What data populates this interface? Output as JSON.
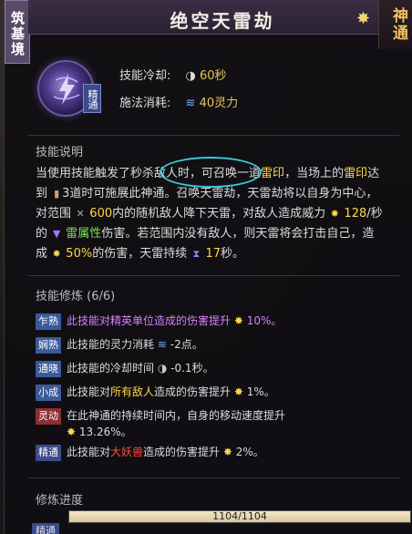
{
  "header": {
    "realm": "筑基境",
    "title": "绝空天雷劫",
    "badge": "神通"
  },
  "skill": {
    "grade": "精通",
    "cooldown_label": "技能冷却:",
    "cooldown_value": "60秒",
    "cost_label": "施法消耗:",
    "cost_value": "40灵力"
  },
  "description": {
    "title": "技能说明",
    "line1_a": "当使用技能",
    "line1_b": "触发了秒杀敌人",
    "line1_c": "时，可召唤一道",
    "line1_d": "雷印",
    "line1_e": "，当场上的",
    "line1_f": "雷印",
    "line1_g": "达",
    "line2_a": "到",
    "line2_b": "3道时可施展此神通。召唤天雷劫，天雷劫将以自身为中心，",
    "line3_a": "对范围",
    "line3_b": "600",
    "line3_c": "内的随机敌人降下天雷，对敌人造成威力",
    "line3_d": "128",
    "line3_e": "/秒",
    "line4_a": "的",
    "line4_b": "雷属性",
    "line4_c": "伤害。若范围内没有敌人，则天雷将会打击自己，造",
    "line5_a": "成",
    "line5_b": "50%",
    "line5_c": "的伤害，天雷持续",
    "line5_d": "17",
    "line5_e": "秒。"
  },
  "cultivation": {
    "title": "技能修炼 (6/6)",
    "rows": [
      {
        "tag": "乍熟",
        "a": "此技能对精英单位造成的伤害提升",
        "b": "10%。"
      },
      {
        "tag": "娴熟",
        "a": "此技能的灵力消耗",
        "b": "-2点。"
      },
      {
        "tag": "通晓",
        "a": "此技能的冷却时间",
        "b": "-0.1秒。"
      },
      {
        "tag": "小成",
        "a": "此技能对",
        "h": "所有敌人",
        "a2": "造成的伤害提升",
        "b": "1%。"
      },
      {
        "tag": "灵动",
        "a": "在此神通的持续时间内，自身的移动速度提升",
        "b": "13.26%。"
      },
      {
        "tag": "精通",
        "a": "此技能对",
        "h": "大妖兽",
        "a2": "造成的伤害提升",
        "b": "2%。"
      }
    ]
  },
  "progress": {
    "label": "修炼进度",
    "text": "1104/1104",
    "fraction": 1.0,
    "bottom_tag": "精通"
  },
  "colors": {
    "highlight_yellow": "#ffd74a",
    "highlight_green": "#7ee05a",
    "highlight_purple": "#d780ff",
    "highlight_red": "#ff4a3a",
    "annotation_cyan": "#3cc8d6"
  },
  "icons": [
    "spark-icon",
    "clock-icon",
    "mana-icon",
    "scroll-icon",
    "range-icon",
    "lightning-icon"
  ]
}
